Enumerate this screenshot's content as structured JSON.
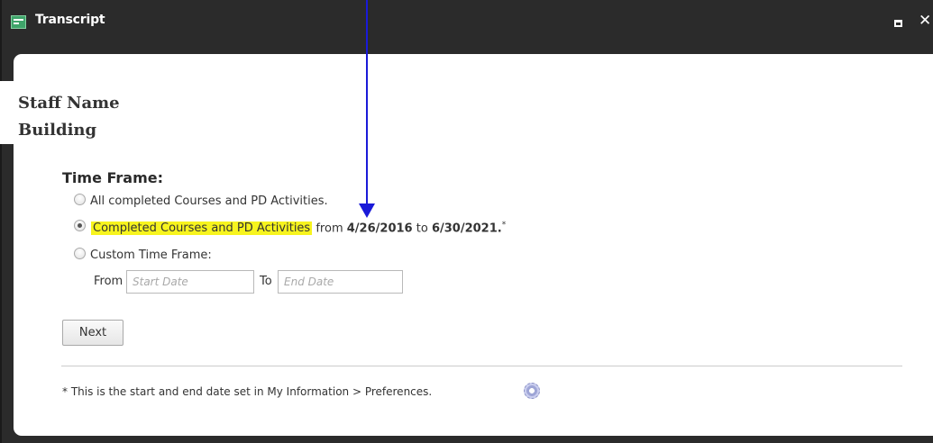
{
  "window": {
    "title": "Transcript"
  },
  "overlay": {
    "staff_name": "Staff Name",
    "building": "Building"
  },
  "time_frame": {
    "title": "Time Frame:",
    "options": [
      {
        "label": "All completed Courses and PD Activities.",
        "selected": false
      },
      {
        "label": "Completed Courses and PD Activities",
        "from_word": "from",
        "start_date": "4/26/2016",
        "to_word": "to",
        "end_date": "6/30/2021",
        "period": ".",
        "footnote_mark": "*",
        "selected": true
      },
      {
        "label": "Custom Time Frame:",
        "selected": false
      }
    ],
    "custom": {
      "from_label": "From",
      "start_placeholder": "Start Date",
      "to_label": "To",
      "end_placeholder": "End Date"
    }
  },
  "actions": {
    "next_label": "Next"
  },
  "footnote": "* This is the start and end date set in My Information > Preferences.",
  "icons": {
    "window": "transcript-window-icon",
    "maximize": "maximize-icon",
    "close": "close-icon",
    "preferences": "gear-icon"
  },
  "colors": {
    "titlebar": "#2b2b2b",
    "highlight": "#f7f41e",
    "annotation_arrow": "#1a1ad8",
    "window_icon": "#3fa46a"
  }
}
